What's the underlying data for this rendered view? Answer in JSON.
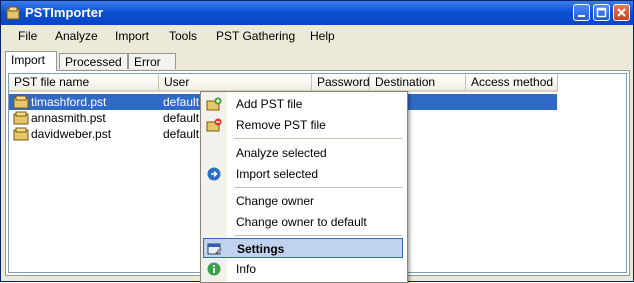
{
  "window": {
    "title": "PSTImporter"
  },
  "menu": [
    "File",
    "Analyze",
    "Import",
    "Tools",
    "PST Gathering",
    "Help"
  ],
  "tabs": [
    "Import",
    "Processed",
    "Error"
  ],
  "columns": [
    "PST file name",
    "User",
    "Password",
    "Destination folder",
    "Access method"
  ],
  "rows": [
    {
      "file": "timashford.pst",
      "user": "default",
      "selected": true
    },
    {
      "file": "annasmith.pst",
      "user": "default",
      "selected": false
    },
    {
      "file": "davidweber.pst",
      "user": "default",
      "selected": false
    }
  ],
  "context_menu": {
    "items": [
      {
        "label": "Add PST file",
        "icon": "add-pst-icon"
      },
      {
        "label": "Remove PST file",
        "icon": "remove-pst-icon"
      },
      {
        "label": "Analyze selected",
        "icon": ""
      },
      {
        "label": "Import selected",
        "icon": "import-icon"
      },
      {
        "label": "Change owner",
        "icon": ""
      },
      {
        "label": "Change owner to default",
        "icon": ""
      },
      {
        "label": "Settings",
        "icon": "settings-icon",
        "highlighted": true
      },
      {
        "label": "Info",
        "icon": "info-icon"
      }
    ]
  },
  "colors": {
    "titlebar": "#0a4fd1",
    "selection": "#316ac5",
    "highlight": "#c1d2ee"
  }
}
